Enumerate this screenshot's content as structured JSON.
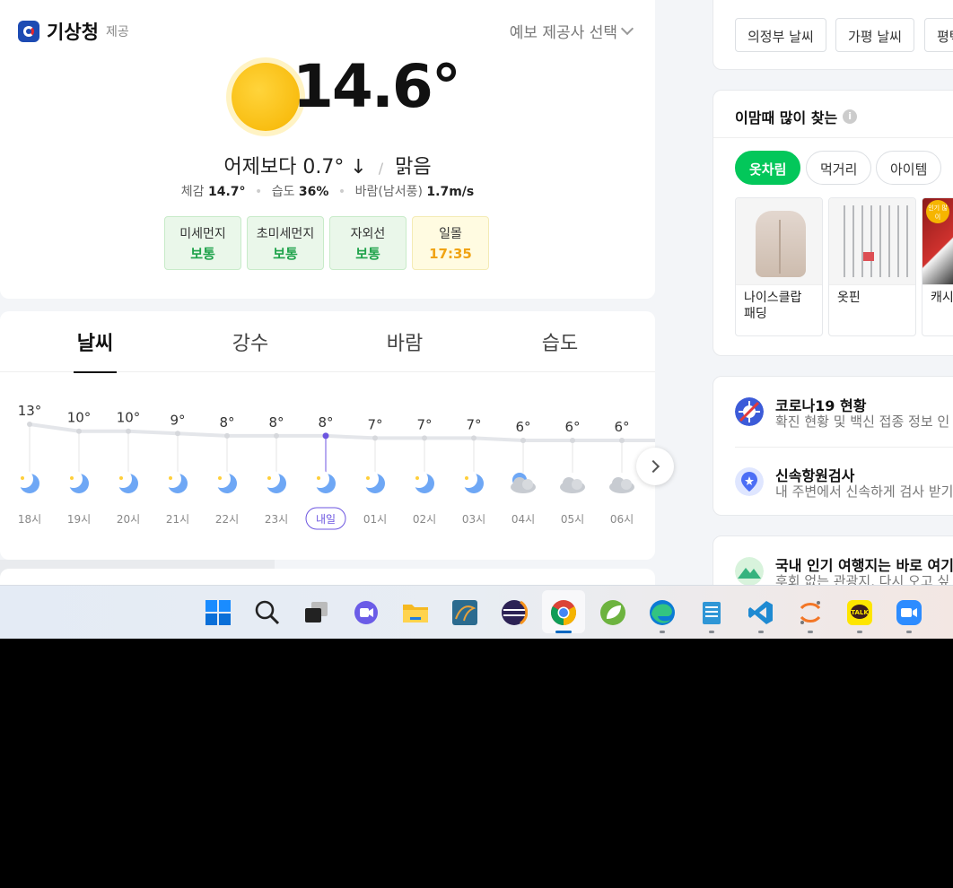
{
  "weather": {
    "provider_name": "기상청",
    "provider_suffix": "제공",
    "provider_select": "예보 제공사 선택",
    "temperature": "14.6°",
    "compare": "어제보다 0.7° ↓",
    "condition": "맑음",
    "feels_label": "체감",
    "feels_value": "14.7°",
    "humidity_label": "습도",
    "humidity_value": "36%",
    "wind_label": "바람(남서풍)",
    "wind_value": "1.7m/s",
    "chips": [
      {
        "label": "미세먼지",
        "value": "보통"
      },
      {
        "label": "초미세먼지",
        "value": "보통"
      },
      {
        "label": "자외선",
        "value": "보통"
      },
      {
        "label": "일몰",
        "value": "17:35"
      }
    ],
    "colors": {
      "good": "#1fa34b",
      "sunset": "#f0a313",
      "accent": "#6c55e0"
    }
  },
  "hourly": {
    "tabs": [
      "날씨",
      "강수",
      "바람",
      "습도"
    ],
    "active_tab": "날씨",
    "entries": [
      {
        "temp": "13°",
        "time": "18시",
        "icon": "moon-icon"
      },
      {
        "temp": "10°",
        "time": "19시",
        "icon": "moon-icon"
      },
      {
        "temp": "10°",
        "time": "20시",
        "icon": "moon-icon"
      },
      {
        "temp": "9°",
        "time": "21시",
        "icon": "moon-icon"
      },
      {
        "temp": "8°",
        "time": "22시",
        "icon": "moon-icon"
      },
      {
        "temp": "8°",
        "time": "23시",
        "icon": "moon-icon"
      },
      {
        "temp": "8°",
        "time": "내일",
        "icon": "moon-icon"
      },
      {
        "temp": "7°",
        "time": "01시",
        "icon": "moon-icon"
      },
      {
        "temp": "7°",
        "time": "02시",
        "icon": "moon-icon"
      },
      {
        "temp": "7°",
        "time": "03시",
        "icon": "moon-icon"
      },
      {
        "temp": "6°",
        "time": "04시",
        "icon": "cloudy-night-icon"
      },
      {
        "temp": "6°",
        "time": "05시",
        "icon": "cloud-icon"
      },
      {
        "temp": "6°",
        "time": "06시",
        "icon": "cloud-icon"
      }
    ]
  },
  "regions": [
    "의정부 날씨",
    "가평 날씨",
    "평택"
  ],
  "popular": {
    "title": "이맘때 많이 찾는",
    "filters": [
      "옷차림",
      "먹거리",
      "아이템"
    ],
    "active_filter": "옷차림",
    "products": [
      {
        "name": "나이스클랍 패딩"
      },
      {
        "name": "옷핀"
      },
      {
        "name": "캐시 플러"
      }
    ],
    "badge": "인기 많이"
  },
  "services": [
    {
      "title": "코로나19 현황",
      "sub": "확진 현황 및 백신 접종 정보 인"
    },
    {
      "title": "신속항원검사",
      "sub": "내 주변에서 신속하게 검사 받기"
    }
  ],
  "travel": {
    "title": "국내 인기 여행지는 바로 여기",
    "sub": "후회 없는 관광지, 다시 오고 싶"
  },
  "taskbar": {
    "icons": [
      "windows-start-icon",
      "search-icon",
      "task-view-icon",
      "teams-chat-icon",
      "file-explorer-icon",
      "mysql-workbench-icon",
      "eclipse-icon",
      "chrome-icon",
      "spring-tools-icon",
      "edge-icon",
      "notepad-icon",
      "vscode-icon",
      "jupyter-icon",
      "kakaotalk-icon",
      "zoom-icon"
    ]
  }
}
